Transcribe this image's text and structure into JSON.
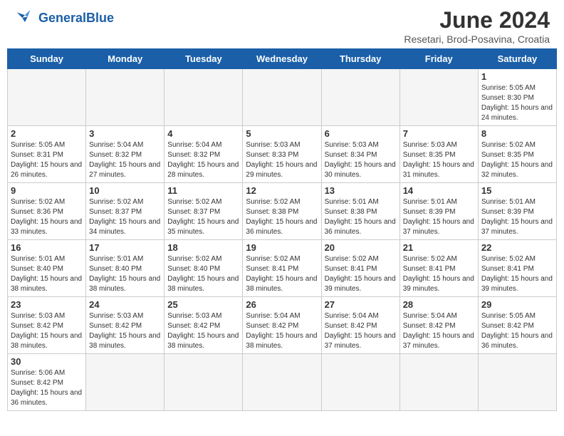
{
  "header": {
    "logo_text_general": "General",
    "logo_text_blue": "Blue",
    "month_title": "June 2024",
    "location": "Resetari, Brod-Posavina, Croatia"
  },
  "days_of_week": [
    "Sunday",
    "Monday",
    "Tuesday",
    "Wednesday",
    "Thursday",
    "Friday",
    "Saturday"
  ],
  "weeks": [
    [
      {
        "day": "",
        "info": ""
      },
      {
        "day": "",
        "info": ""
      },
      {
        "day": "",
        "info": ""
      },
      {
        "day": "",
        "info": ""
      },
      {
        "day": "",
        "info": ""
      },
      {
        "day": "",
        "info": ""
      },
      {
        "day": "1",
        "info": "Sunrise: 5:05 AM\nSunset: 8:30 PM\nDaylight: 15 hours and 24 minutes."
      }
    ],
    [
      {
        "day": "2",
        "info": "Sunrise: 5:05 AM\nSunset: 8:31 PM\nDaylight: 15 hours and 26 minutes."
      },
      {
        "day": "3",
        "info": "Sunrise: 5:04 AM\nSunset: 8:32 PM\nDaylight: 15 hours and 27 minutes."
      },
      {
        "day": "4",
        "info": "Sunrise: 5:04 AM\nSunset: 8:32 PM\nDaylight: 15 hours and 28 minutes."
      },
      {
        "day": "5",
        "info": "Sunrise: 5:03 AM\nSunset: 8:33 PM\nDaylight: 15 hours and 29 minutes."
      },
      {
        "day": "6",
        "info": "Sunrise: 5:03 AM\nSunset: 8:34 PM\nDaylight: 15 hours and 30 minutes."
      },
      {
        "day": "7",
        "info": "Sunrise: 5:03 AM\nSunset: 8:35 PM\nDaylight: 15 hours and 31 minutes."
      },
      {
        "day": "8",
        "info": "Sunrise: 5:02 AM\nSunset: 8:35 PM\nDaylight: 15 hours and 32 minutes."
      }
    ],
    [
      {
        "day": "9",
        "info": "Sunrise: 5:02 AM\nSunset: 8:36 PM\nDaylight: 15 hours and 33 minutes."
      },
      {
        "day": "10",
        "info": "Sunrise: 5:02 AM\nSunset: 8:37 PM\nDaylight: 15 hours and 34 minutes."
      },
      {
        "day": "11",
        "info": "Sunrise: 5:02 AM\nSunset: 8:37 PM\nDaylight: 15 hours and 35 minutes."
      },
      {
        "day": "12",
        "info": "Sunrise: 5:02 AM\nSunset: 8:38 PM\nDaylight: 15 hours and 36 minutes."
      },
      {
        "day": "13",
        "info": "Sunrise: 5:01 AM\nSunset: 8:38 PM\nDaylight: 15 hours and 36 minutes."
      },
      {
        "day": "14",
        "info": "Sunrise: 5:01 AM\nSunset: 8:39 PM\nDaylight: 15 hours and 37 minutes."
      },
      {
        "day": "15",
        "info": "Sunrise: 5:01 AM\nSunset: 8:39 PM\nDaylight: 15 hours and 37 minutes."
      }
    ],
    [
      {
        "day": "16",
        "info": "Sunrise: 5:01 AM\nSunset: 8:40 PM\nDaylight: 15 hours and 38 minutes."
      },
      {
        "day": "17",
        "info": "Sunrise: 5:01 AM\nSunset: 8:40 PM\nDaylight: 15 hours and 38 minutes."
      },
      {
        "day": "18",
        "info": "Sunrise: 5:02 AM\nSunset: 8:40 PM\nDaylight: 15 hours and 38 minutes."
      },
      {
        "day": "19",
        "info": "Sunrise: 5:02 AM\nSunset: 8:41 PM\nDaylight: 15 hours and 38 minutes."
      },
      {
        "day": "20",
        "info": "Sunrise: 5:02 AM\nSunset: 8:41 PM\nDaylight: 15 hours and 39 minutes."
      },
      {
        "day": "21",
        "info": "Sunrise: 5:02 AM\nSunset: 8:41 PM\nDaylight: 15 hours and 39 minutes."
      },
      {
        "day": "22",
        "info": "Sunrise: 5:02 AM\nSunset: 8:41 PM\nDaylight: 15 hours and 39 minutes."
      }
    ],
    [
      {
        "day": "23",
        "info": "Sunrise: 5:03 AM\nSunset: 8:42 PM\nDaylight: 15 hours and 38 minutes."
      },
      {
        "day": "24",
        "info": "Sunrise: 5:03 AM\nSunset: 8:42 PM\nDaylight: 15 hours and 38 minutes."
      },
      {
        "day": "25",
        "info": "Sunrise: 5:03 AM\nSunset: 8:42 PM\nDaylight: 15 hours and 38 minutes."
      },
      {
        "day": "26",
        "info": "Sunrise: 5:04 AM\nSunset: 8:42 PM\nDaylight: 15 hours and 38 minutes."
      },
      {
        "day": "27",
        "info": "Sunrise: 5:04 AM\nSunset: 8:42 PM\nDaylight: 15 hours and 37 minutes."
      },
      {
        "day": "28",
        "info": "Sunrise: 5:04 AM\nSunset: 8:42 PM\nDaylight: 15 hours and 37 minutes."
      },
      {
        "day": "29",
        "info": "Sunrise: 5:05 AM\nSunset: 8:42 PM\nDaylight: 15 hours and 36 minutes."
      }
    ],
    [
      {
        "day": "30",
        "info": "Sunrise: 5:06 AM\nSunset: 8:42 PM\nDaylight: 15 hours and 36 minutes."
      },
      {
        "day": "",
        "info": ""
      },
      {
        "day": "",
        "info": ""
      },
      {
        "day": "",
        "info": ""
      },
      {
        "day": "",
        "info": ""
      },
      {
        "day": "",
        "info": ""
      },
      {
        "day": "",
        "info": ""
      }
    ]
  ]
}
